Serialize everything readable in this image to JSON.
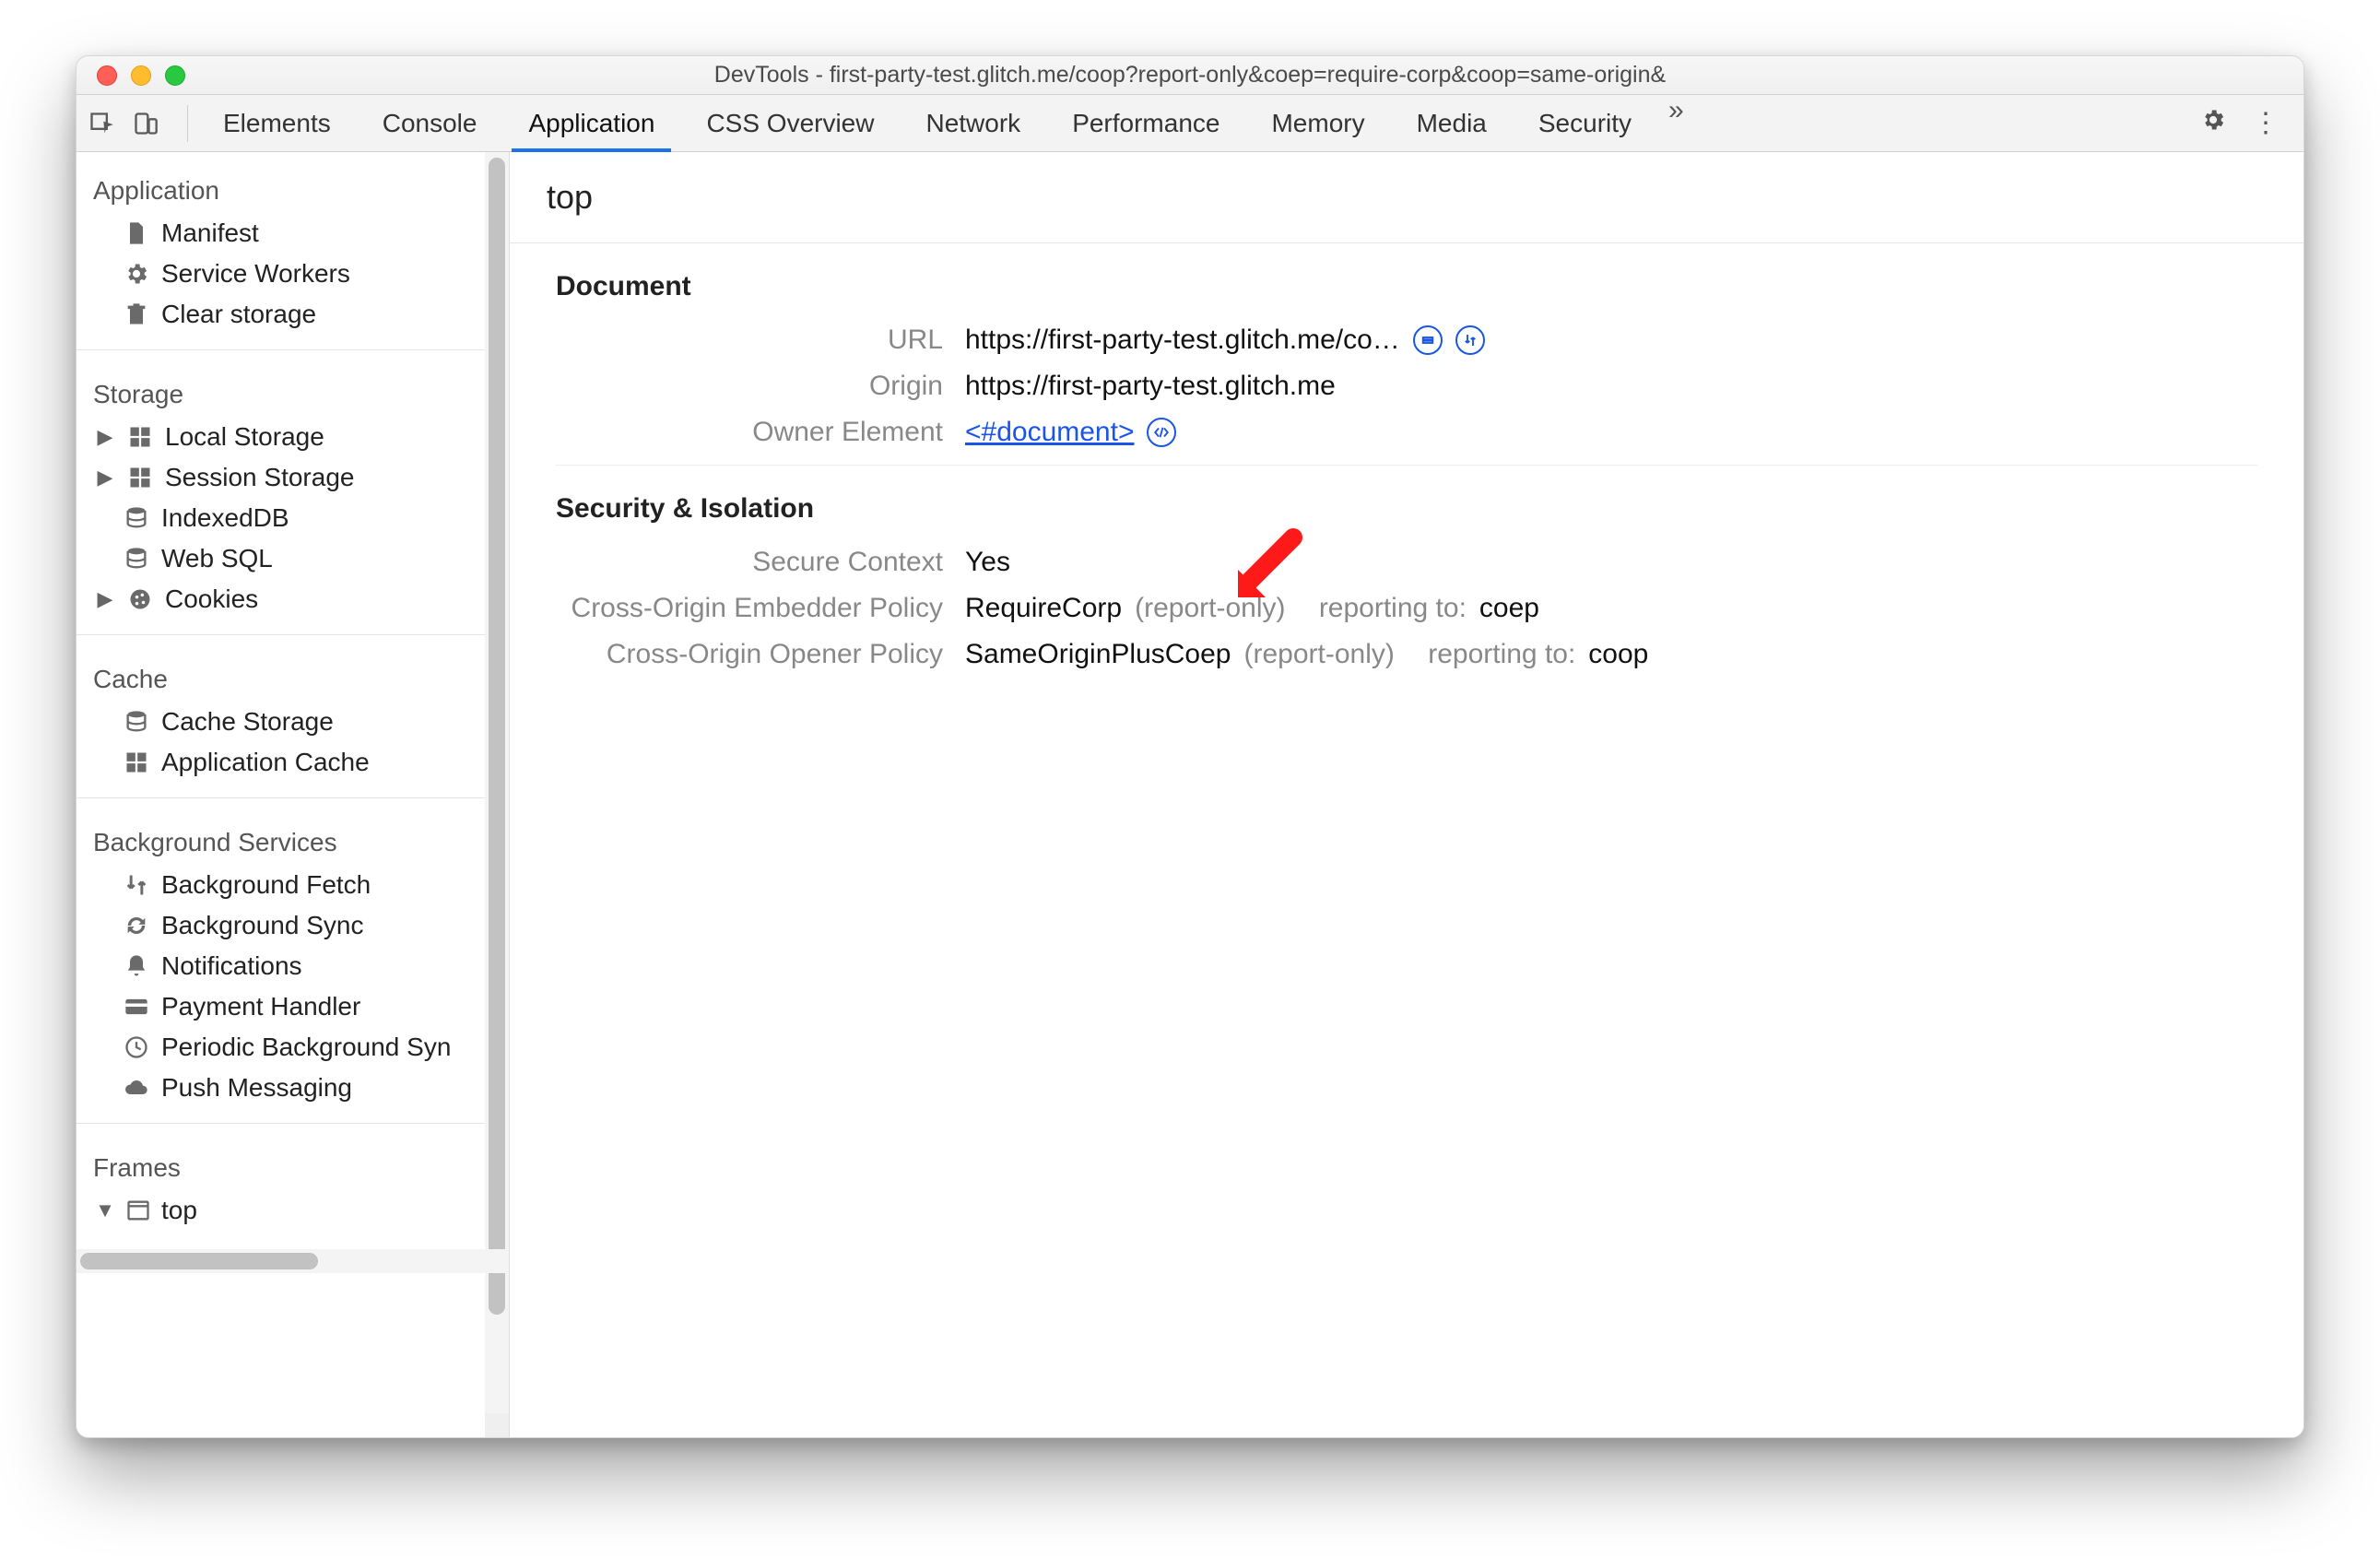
{
  "window": {
    "title": "DevTools - first-party-test.glitch.me/coop?report-only&coep=require-corp&coop=same-origin&"
  },
  "tabs": {
    "items": [
      "Elements",
      "Console",
      "Application",
      "CSS Overview",
      "Network",
      "Performance",
      "Memory",
      "Media",
      "Security"
    ],
    "active_index": 2
  },
  "sidebar": {
    "sections": [
      {
        "title": "Application",
        "items": [
          {
            "icon": "file-icon",
            "label": "Manifest"
          },
          {
            "icon": "gear-icon",
            "label": "Service Workers"
          },
          {
            "icon": "trash-icon",
            "label": "Clear storage"
          }
        ]
      },
      {
        "title": "Storage",
        "items": [
          {
            "caret": "▶",
            "icon": "grid-icon",
            "label": "Local Storage"
          },
          {
            "caret": "▶",
            "icon": "grid-icon",
            "label": "Session Storage"
          },
          {
            "icon": "database-icon",
            "label": "IndexedDB"
          },
          {
            "icon": "database-icon",
            "label": "Web SQL"
          },
          {
            "caret": "▶",
            "icon": "cookie-icon",
            "label": "Cookies"
          }
        ]
      },
      {
        "title": "Cache",
        "items": [
          {
            "icon": "database-icon",
            "label": "Cache Storage"
          },
          {
            "icon": "grid-icon",
            "label": "Application Cache"
          }
        ]
      },
      {
        "title": "Background Services",
        "items": [
          {
            "icon": "updown-icon",
            "label": "Background Fetch"
          },
          {
            "icon": "sync-icon",
            "label": "Background Sync"
          },
          {
            "icon": "bell-icon",
            "label": "Notifications"
          },
          {
            "icon": "card-icon",
            "label": "Payment Handler"
          },
          {
            "icon": "clock-icon",
            "label": "Periodic Background Syn"
          },
          {
            "icon": "cloud-icon",
            "label": "Push Messaging"
          }
        ]
      },
      {
        "title": "Frames",
        "items": [
          {
            "caret": "▼",
            "icon": "window-icon",
            "label": "top"
          }
        ]
      }
    ]
  },
  "main": {
    "frame_title": "top",
    "document": {
      "heading": "Document",
      "rows": {
        "url_label": "URL",
        "url_value": "https://first-party-test.glitch.me/co…",
        "origin_label": "Origin",
        "origin_value": "https://first-party-test.glitch.me",
        "owner_label": "Owner Element",
        "owner_value": "<#document>"
      }
    },
    "security": {
      "heading": "Security & Isolation",
      "rows": {
        "secure_context_label": "Secure Context",
        "secure_context_value": "Yes",
        "coep_label": "Cross-Origin Embedder Policy",
        "coep_value": "RequireCorp",
        "coep_mode": "(report-only)",
        "coep_reporting_label": "reporting to:",
        "coep_reporting_value": "coep",
        "coop_label": "Cross-Origin Opener Policy",
        "coop_value": "SameOriginPlusCoep",
        "coop_mode": "(report-only)",
        "coop_reporting_label": "reporting to:",
        "coop_reporting_value": "coop"
      }
    }
  }
}
